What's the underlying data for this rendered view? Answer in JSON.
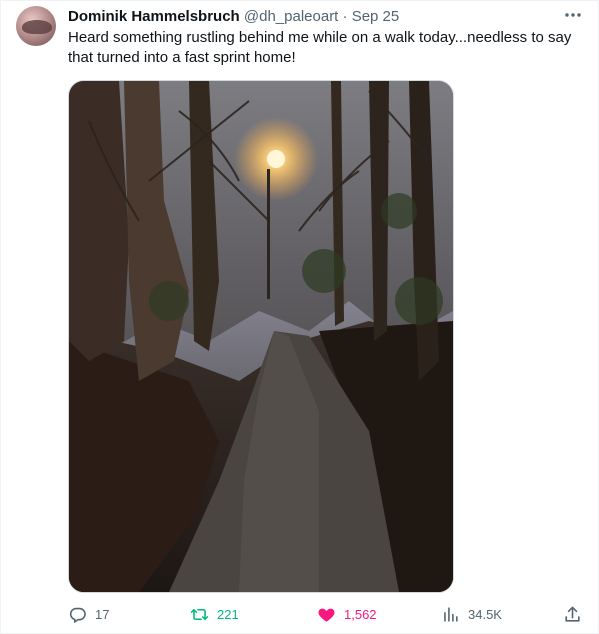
{
  "post": {
    "display_name": "Dominik Hammelsbruch",
    "handle": "@dh_paleoart",
    "separator": "·",
    "date": "Sep 25",
    "text": "Heard something rustling behind me while on a walk today...needless to say that turned into a fast sprint home!",
    "media_icon": "photo-of-dark-forest-path-with-street-lamp"
  },
  "actions": {
    "replies": "17",
    "retweets": "221",
    "likes": "1,562",
    "views": "34.5K"
  },
  "colors": {
    "retweet_active": "#00ba7c",
    "like_active": "#f91880",
    "muted": "#536471",
    "text": "#0f1419"
  },
  "icons": {
    "more": "more-dots-icon",
    "reply": "reply-icon",
    "retweet": "retweet-icon",
    "like": "heart-icon",
    "views": "analytics-icon",
    "share": "share-icon"
  }
}
